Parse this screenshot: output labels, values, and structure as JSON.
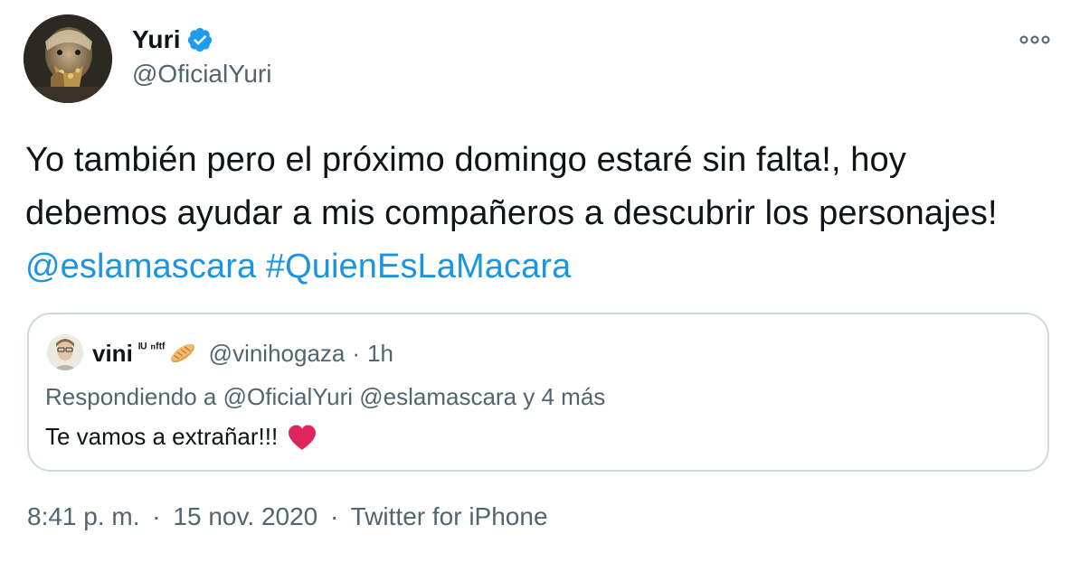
{
  "author": {
    "display_name": "Yuri",
    "handle": "@OficialYuri",
    "verified": true,
    "avatar_icon": "profile-photo"
  },
  "tweet": {
    "text_part1": "Yo también pero el próximo domingo estaré sin falta!, hoy debemos ayudar a mis compañeros a descubrir los personajes! ",
    "mention": "@eslamascara",
    "text_space": " ",
    "hashtag": "#QuienEsLaMacara"
  },
  "quoted": {
    "display_name": "vini",
    "name_superscript": "ᴵᵁ ⁿᶠᵗᶠ",
    "emoji_icon": "bread-icon",
    "handle": "@vinihogaza",
    "separator": "·",
    "time": "1h",
    "reply_text": "Respondiendo a @OficialYuri @eslamascara y 4 más",
    "body": "Te vamos a extrañar!!!",
    "emoji_end_icon": "heart-icon"
  },
  "footer": {
    "time": "8:41 p. m.",
    "sep1": "·",
    "date": "15 nov. 2020",
    "sep2": "·",
    "source": "Twitter for iPhone"
  },
  "colors": {
    "link": "#1b95e0",
    "verified": "#1d9bf0",
    "secondary_text": "#536471",
    "border": "#cfd9de",
    "heart": "#e0245e"
  }
}
